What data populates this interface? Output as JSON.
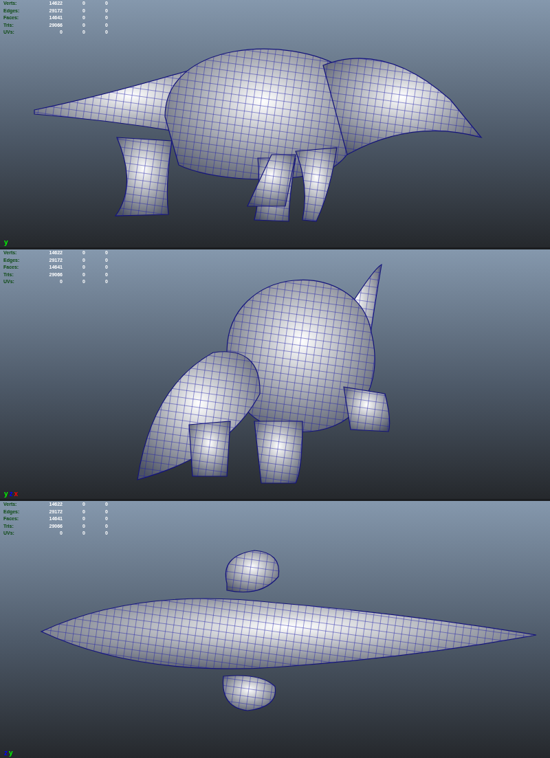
{
  "viewports": [
    {
      "kind": "side",
      "hud": [
        {
          "label": "Verts:",
          "values": [
            "14622",
            "0",
            "0"
          ]
        },
        {
          "label": "Edges:",
          "values": [
            "29172",
            "0",
            "0"
          ]
        },
        {
          "label": "Faces:",
          "values": [
            "14641",
            "0",
            "0"
          ]
        },
        {
          "label": "Tris:",
          "values": [
            "29066",
            "0",
            "0"
          ]
        },
        {
          "label": "UVs:",
          "values": [
            "0",
            "0",
            "0"
          ]
        }
      ],
      "axis": [
        {
          "label": "y",
          "color": "#00ff00"
        }
      ]
    },
    {
      "kind": "three_quarter",
      "hud": [
        {
          "label": "Verts:",
          "values": [
            "14622",
            "0",
            "0"
          ]
        },
        {
          "label": "Edges:",
          "values": [
            "29172",
            "0",
            "0"
          ]
        },
        {
          "label": "Faces:",
          "values": [
            "14641",
            "0",
            "0"
          ]
        },
        {
          "label": "Tris:",
          "values": [
            "29066",
            "0",
            "0"
          ]
        },
        {
          "label": "UVs:",
          "values": [
            "0",
            "0",
            "0"
          ]
        }
      ],
      "axis": [
        {
          "label": "y",
          "color": "#00ff00"
        },
        {
          "label": "z",
          "color": "#0000ff"
        },
        {
          "label": "x",
          "color": "#ff0000"
        }
      ]
    },
    {
      "kind": "top",
      "hud": [
        {
          "label": "Verts:",
          "values": [
            "14622",
            "0",
            "0"
          ]
        },
        {
          "label": "Edges:",
          "values": [
            "29172",
            "0",
            "0"
          ]
        },
        {
          "label": "Faces:",
          "values": [
            "14641",
            "0",
            "0"
          ]
        },
        {
          "label": "Tris:",
          "values": [
            "29066",
            "0",
            "0"
          ]
        },
        {
          "label": "UVs:",
          "values": [
            "0",
            "0",
            "0"
          ]
        }
      ],
      "axis": [
        {
          "label": "z",
          "color": "#0000ff"
        },
        {
          "label": "y",
          "color": "#00ff00"
        }
      ]
    }
  ]
}
